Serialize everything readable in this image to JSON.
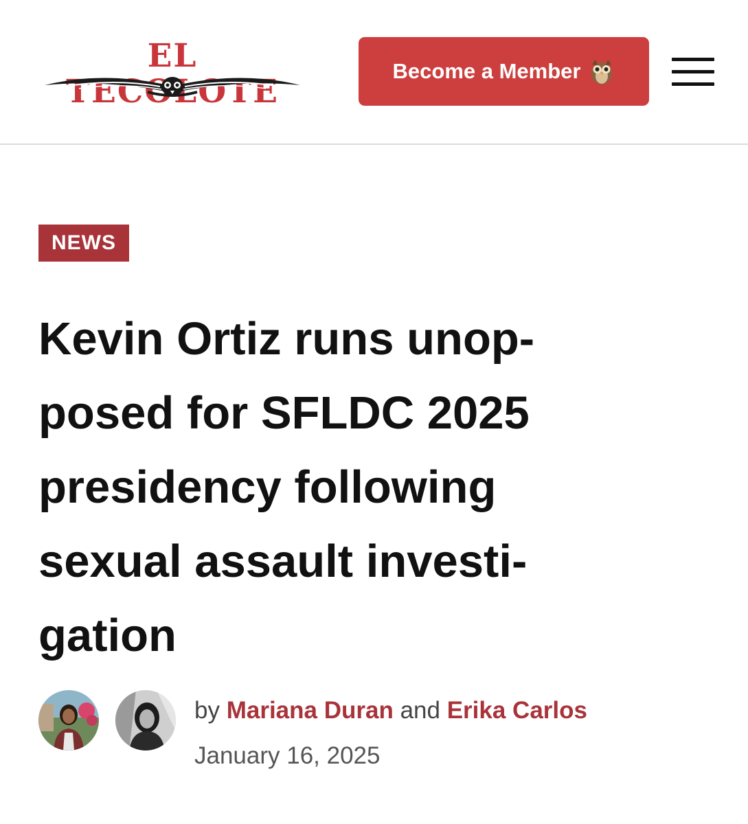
{
  "header": {
    "logo_text": "EL TECOLOTE",
    "member_button_label": "Become a Member",
    "member_button_icon": "owl-emoji",
    "menu_icon": "hamburger-menu-icon"
  },
  "article": {
    "category": "NEWS",
    "headline_lines": [
      "Kevin Ortiz runs unop-",
      "posed for SFLDC 2025",
      "presidency following",
      "sexual assault investi-",
      "gation"
    ],
    "byline": {
      "prefix": "by",
      "authors": [
        "Mariana Duran",
        "Erika Carlos"
      ],
      "conjunction": "and",
      "date": "January 16, 2025"
    }
  },
  "colors": {
    "brand_red": "#cc3f3e",
    "category_red": "#a8343a",
    "author_red": "#a8343a",
    "text": "#111111"
  }
}
